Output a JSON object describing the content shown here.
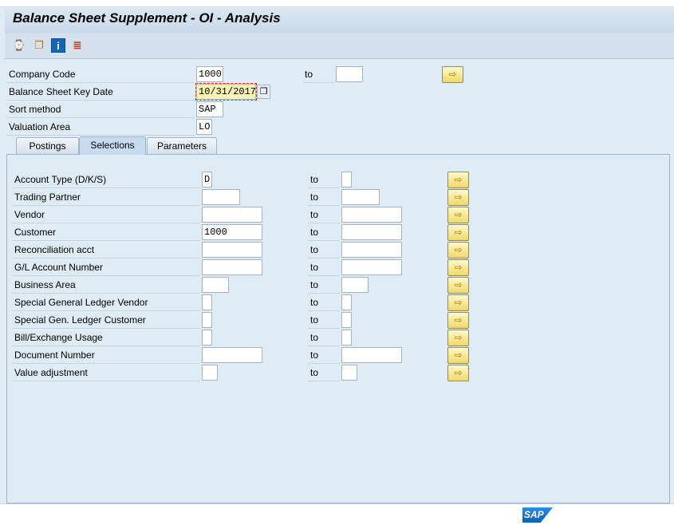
{
  "window": {
    "title": "Balance Sheet Supplement - OI - Analysis"
  },
  "toolbar": {
    "icons": [
      "execute-icon",
      "variant-icon",
      "info-icon",
      "selection-options-icon"
    ]
  },
  "header_fields": {
    "company_code": {
      "label": "Company Code",
      "value": "1000",
      "to_label": "to",
      "to_value": ""
    },
    "key_date": {
      "label": "Balance Sheet Key Date",
      "value": "10/31/2017"
    },
    "sort_method": {
      "label": "Sort method",
      "value": "SAP"
    },
    "valuation_area": {
      "label": "Valuation Area",
      "value": "LO"
    }
  },
  "tabs": [
    {
      "label": "Postings"
    },
    {
      "label": "Selections",
      "active": true
    },
    {
      "label": "Parameters"
    }
  ],
  "selections": [
    {
      "label": "Account Type (D/K/S)",
      "from": "D",
      "to": ""
    },
    {
      "label": "Trading Partner",
      "from": "",
      "to": ""
    },
    {
      "label": "Vendor",
      "from": "",
      "to": ""
    },
    {
      "label": "Customer",
      "from": "1000",
      "to": ""
    },
    {
      "label": "Reconciliation acct",
      "from": "",
      "to": ""
    },
    {
      "label": "G/L Account Number",
      "from": "",
      "to": ""
    },
    {
      "label": "Business Area",
      "from": "",
      "to": ""
    },
    {
      "label": "Special General Ledger Vendor",
      "from": "",
      "to": ""
    },
    {
      "label": "Special Gen. Ledger Customer",
      "from": "",
      "to": ""
    },
    {
      "label": "Bill/Exchange Usage",
      "from": "",
      "to": ""
    },
    {
      "label": "Document Number",
      "from": "",
      "to": ""
    },
    {
      "label": "Value adjustment",
      "from": "",
      "to": ""
    }
  ],
  "to_label": "to",
  "footer": {
    "logo": "SAP"
  }
}
